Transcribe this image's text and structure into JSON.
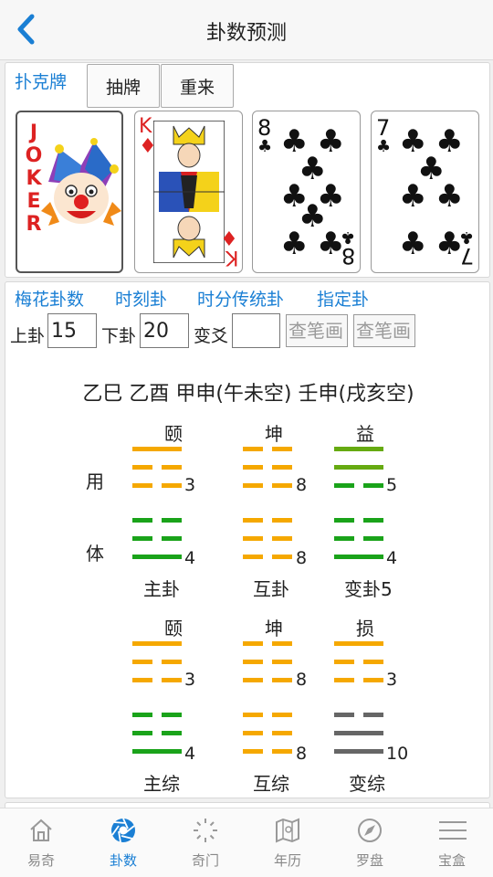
{
  "header": {
    "title": "卦数预测"
  },
  "poker": {
    "label": "扑克牌",
    "draw_label": "抽牌",
    "reset_label": "重来",
    "joker_text": [
      "J",
      "O",
      "K",
      "E",
      "R"
    ],
    "king": {
      "rank": "K",
      "suit": "♦"
    },
    "club8": {
      "rank": "8",
      "suit": "♣"
    },
    "club7": {
      "rank": "7",
      "suit": "♣"
    }
  },
  "tabs": [
    "梅花卦数",
    "时刻卦",
    "时分传统卦",
    "指定卦"
  ],
  "inputs": {
    "upper_label": "上卦",
    "upper_value": "15",
    "lower_label": "下卦",
    "lower_value": "20",
    "change_label": "变爻",
    "change_value": "",
    "lookup1": "查笔画",
    "lookup2": "查笔画"
  },
  "ganzhi": "乙巳 乙酉 甲申(午未空) 壬申(戌亥空)",
  "top_group": {
    "use_label": "用",
    "body_label": "体",
    "hexagrams": [
      {
        "name": "颐",
        "upper_num": "3",
        "lower_num": "4",
        "label": "主卦"
      },
      {
        "name": "坤",
        "upper_num": "8",
        "lower_num": "8",
        "label": "互卦"
      },
      {
        "name": "益",
        "upper_num": "5",
        "lower_num": "4",
        "label": "变卦5"
      }
    ]
  },
  "bottom_group": {
    "hexagrams": [
      {
        "name": "颐",
        "upper_num": "3",
        "lower_num": "4",
        "label": "主综"
      },
      {
        "name": "坤",
        "upper_num": "8",
        "lower_num": "8",
        "label": "互综"
      },
      {
        "name": "损",
        "upper_num": "3",
        "lower_num": "10",
        "label": "变综"
      }
    ]
  },
  "colors": {
    "accent": "#1a7fd4",
    "orange": "#f5a800",
    "green": "#1aa31a",
    "lime": "#66aa11",
    "gray": "#666666"
  },
  "navbar": [
    {
      "label": "易奇",
      "icon": "home-icon"
    },
    {
      "label": "卦数",
      "icon": "aperture-icon"
    },
    {
      "label": "奇门",
      "icon": "sun-icon"
    },
    {
      "label": "年历",
      "icon": "map-icon"
    },
    {
      "label": "罗盘",
      "icon": "compass-icon"
    },
    {
      "label": "宝盒",
      "icon": "menu-icon"
    }
  ]
}
